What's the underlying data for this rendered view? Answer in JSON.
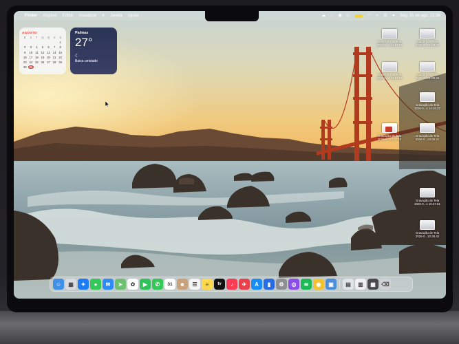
{
  "menubar": {
    "apple": "",
    "items": [
      "Finder",
      "Arquivo",
      "Editar",
      "Visualizar",
      "Ir",
      "Janela",
      "Ajuda"
    ],
    "clock": "Seg. 31 de ago.  22:36",
    "battery_color": "#f2d13a"
  },
  "calendar_widget": {
    "month": "AGOSTO",
    "weekdays": [
      "D",
      "S",
      "T",
      "Q",
      "Q",
      "S",
      "S"
    ],
    "rows": [
      [
        "",
        "",
        "",
        "",
        "",
        "",
        "1"
      ],
      [
        "2",
        "3",
        "4",
        "5",
        "6",
        "7",
        "8"
      ],
      [
        "9",
        "10",
        "11",
        "12",
        "13",
        "14",
        "15"
      ],
      [
        "16",
        "17",
        "18",
        "19",
        "20",
        "21",
        "22"
      ],
      [
        "23",
        "24",
        "25",
        "26",
        "27",
        "28",
        "29"
      ],
      [
        "30",
        "31",
        "",
        "",
        "",
        "",
        ""
      ]
    ],
    "today": "31",
    "accent": "#e63b30"
  },
  "weather_widget": {
    "city": "Palmas",
    "temp": "27°",
    "icon": "cloud-moon-icon",
    "condition": "Baixa umidade"
  },
  "desktop_files": [
    {
      "line1": "Gravação de Tela",
      "line2": "2026-0...s 14.07.02"
    },
    {
      "line1": "Captura de Tela",
      "line2": "2026-0...01.09.00"
    },
    {
      "line1": "Gravação de Tela",
      "line2": "2026-0...s 14.01.16"
    },
    {
      "line1": "Captura de Tela",
      "line2": "2026-0...01.09.34"
    },
    {
      "line1": "Gravação de Tela",
      "line2": "2026-0...s 14.16.37"
    },
    {
      "line1": "Gravação de Tela",
      "line2": "2026-0...22.37.10"
    },
    {
      "line1": "Gravação de Tela",
      "line2": "2026-0...23.05.21"
    },
    {
      "line1": "Gravação de Tela",
      "line2": "2026-0...s 10.27.51"
    },
    {
      "line1": "Gravação de Tela",
      "line2": "2026-0...10.28.42"
    }
  ],
  "dock": {
    "apps": [
      {
        "name": "finder",
        "color": "#3d8fe8",
        "glyph": "☺"
      },
      {
        "name": "launchpad",
        "color": "#d9dbe0",
        "glyph": "▦"
      },
      {
        "name": "safari",
        "color": "#1e7cf2",
        "glyph": "✦"
      },
      {
        "name": "messages",
        "color": "#34c759",
        "glyph": "●"
      },
      {
        "name": "mail",
        "color": "#2f8cf6",
        "glyph": "✉"
      },
      {
        "name": "maps",
        "color": "#6cc070",
        "glyph": "➤"
      },
      {
        "name": "photos",
        "color": "#ffffff",
        "glyph": "✿"
      },
      {
        "name": "facetime",
        "color": "#2fc25a",
        "glyph": "▶"
      },
      {
        "name": "phone",
        "color": "#36c759",
        "glyph": "✆"
      },
      {
        "name": "calendar",
        "color": "#ffffff",
        "glyph": "31"
      },
      {
        "name": "contacts",
        "color": "#c9a27a",
        "glyph": "☻"
      },
      {
        "name": "reminders",
        "color": "#f5f5f5",
        "glyph": "☰"
      },
      {
        "name": "notes",
        "color": "#ffd84d",
        "glyph": "≡"
      },
      {
        "name": "tv",
        "color": "#111111",
        "glyph": "tv"
      },
      {
        "name": "music",
        "color": "#fa3d55",
        "glyph": "♪"
      },
      {
        "name": "testflight",
        "color": "#e8414b",
        "glyph": "✈"
      },
      {
        "name": "app-store",
        "color": "#1a8cf5",
        "glyph": "A"
      },
      {
        "name": "keynote",
        "color": "#2a6be6",
        "glyph": "▮"
      },
      {
        "name": "system-settings",
        "color": "#8e8e93",
        "glyph": "⚙"
      },
      {
        "name": "podcasts",
        "color": "#8a4de8",
        "glyph": "◎"
      },
      {
        "name": "spotify",
        "color": "#1db954",
        "glyph": "≋"
      },
      {
        "name": "chrome",
        "color": "#f1c232",
        "glyph": "◉"
      },
      {
        "name": "preview",
        "color": "#4c8ed9",
        "glyph": "▣"
      }
    ],
    "extras": [
      {
        "name": "downloads-stack",
        "color": "#dfe3ea",
        "glyph": "▤"
      },
      {
        "name": "documents-stack",
        "color": "#f0f0f2",
        "glyph": "▥"
      },
      {
        "name": "recent-stack",
        "color": "#4b4b4f",
        "glyph": "▦"
      },
      {
        "name": "trash",
        "color": "#cfd2d6",
        "glyph": "⌫"
      }
    ]
  }
}
